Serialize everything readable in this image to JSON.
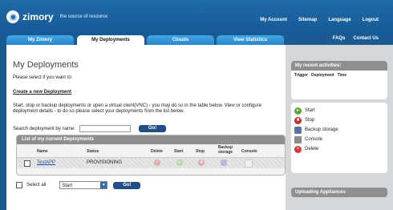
{
  "header": {
    "logo_name": "zimory",
    "tagline": "the source of resource",
    "nav": [
      "My Account",
      "Sitemap",
      "Language",
      "Logout"
    ]
  },
  "tabs": [
    {
      "label": "My Zimory",
      "active": false
    },
    {
      "label": "My Deployments",
      "active": true
    },
    {
      "label": "Clouds",
      "active": false
    },
    {
      "label": "View Statistics",
      "active": false
    }
  ],
  "right_links": [
    "FAQs",
    "Contact Us"
  ],
  "main": {
    "title": "My Deployments",
    "intro": "Please select if you want to:",
    "create_link": "Create a new Deployment",
    "desc1": "Start, stop or backup deployments or open a virtual client(VNC) - you may do so in the table below. View or configure",
    "desc2": "deployment details - to do so please select your deployments from the list below.",
    "search_label": "Search deployment by name:",
    "search_value": "",
    "go_label": "Go!",
    "table": {
      "title": "List of my current Deployments",
      "columns": [
        "Name",
        "Status",
        "Delete",
        "Start",
        "Stop",
        "Backup storage",
        "Console"
      ],
      "rows": [
        {
          "name": "TestAPP",
          "status": "PROVISIONING"
        }
      ]
    },
    "select_all_label": "Select all",
    "action_value": "Start",
    "go2_label": "Go!"
  },
  "sidebar": {
    "recent_title": "My recent activities:",
    "recent_cols": [
      "Trigger",
      "Deployment",
      "Time"
    ],
    "legend": [
      {
        "label": "Start",
        "icon": "start-icon",
        "color": "#5aa832"
      },
      {
        "label": "Stop",
        "icon": "stop-icon",
        "color": "#cc2b2b"
      },
      {
        "label": "Backup storage",
        "icon": "backup-icon",
        "color": "#5b6fa8"
      },
      {
        "label": "Console",
        "icon": "console-icon",
        "color": "#8a8a8a"
      },
      {
        "label": "Delete",
        "icon": "delete-icon",
        "color": "#d23a3a"
      }
    ],
    "uploading_title": "Uploading Appliances"
  },
  "colors": {
    "brand": "#1d5a92",
    "tab": "#2a87cc",
    "panel_head": "#8f8f8f"
  }
}
